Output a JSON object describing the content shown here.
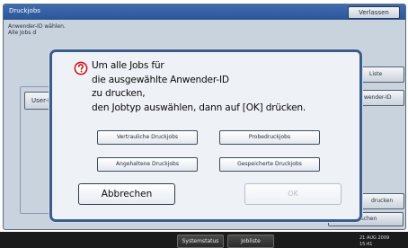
{
  "background": {
    "title": "Druckjobs",
    "exit_label": "Verlassen",
    "info_line1": "Anwender-ID wählen.",
    "info_line2": "Alle Jobs d",
    "user_tab_label": "User-ID",
    "right_button_1": "Liste",
    "right_button_2": "wender-ID",
    "right_button_3": "drucken",
    "bottom_button": "Löschen"
  },
  "dialog": {
    "icon": "question-mark-icon",
    "message": "Um alle Jobs für\ndie ausgewählte Anwender-ID\nzu drucken,\nden Jobtyp auswählen, dann auf [OK] drücken.",
    "job_types": {
      "confidential": "Vertrauliche Druckjobs",
      "sample": "Probedruckjobs",
      "hold": "Angehaltene Druckjobs",
      "stored": "Gespeicherte Druckjobs"
    },
    "cancel_label": "Abbrechen",
    "ok_label": "OK"
  },
  "status_bar": {
    "system_status_label": "Systemstatus",
    "job_list_label": "Jobliste",
    "date": "21 AUG 2009",
    "time": "15:41"
  },
  "colors": {
    "header": "#2c5597",
    "dialog_border": "#3c5d8c",
    "icon_red": "#c8141c"
  }
}
